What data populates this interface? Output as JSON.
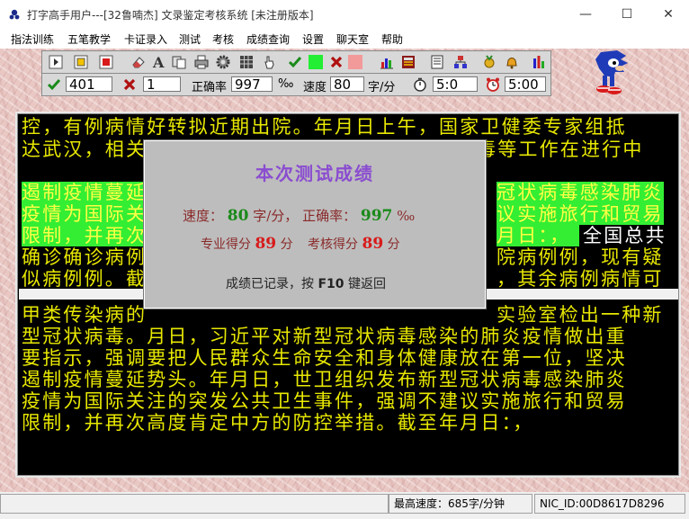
{
  "window": {
    "title": "打字高手用户---[32鲁喃杰]      文录鉴定考核系统  [未注册版本]",
    "minimize": "—",
    "maximize": "☐",
    "close": "✕"
  },
  "menu": [
    "指法训练",
    "五笔教学",
    "卡证录入",
    "测试",
    "考核",
    "成绩查询",
    "设置",
    "聊天室",
    "帮助"
  ],
  "toolbar_icons": [
    "play-icon",
    "stop-square-icon",
    "record-square-icon",
    "eraser-icon",
    "font-a-icon",
    "copy-files-icon",
    "printer-icon",
    "settings-gear-icon",
    "keyboard-grid-icon",
    "hand-pointer-icon",
    "green-check-icon",
    "green-swatch-icon",
    "red-x-icon",
    "pink-swatch-icon",
    "bar-chart-icon",
    "calculator-icon",
    "registry-icon",
    "network-icon",
    "medal-icon",
    "bell-icon",
    "equalizer-icon"
  ],
  "stats": {
    "correct_count": "401",
    "error_count": "1",
    "accuracy_label": "正确率",
    "accuracy_value": "997",
    "accuracy_unit": "‰",
    "speed_label": "速度",
    "speed_value": "80",
    "speed_unit": "字/分",
    "elapsed_time": "5:0",
    "limit_time": "5:00"
  },
  "typing": {
    "top_lines": [
      "控，有例病情好转拟近期出院。年月日上午，国家卫健委专家组抵",
      "达武汉，相关",
      "遏制疫情蔓延",
      "疫情为国际关",
      "限制，并再次",
      "确诊确诊病例",
      "似病例例。截"
    ],
    "right_fragments": [
      "毒等工作在进行中",
      "冠状病毒感染肺炎",
      "议实施旅行和贸易",
      "月日：，",
      "全国总共",
      "院病例例，现有疑",
      "，其余病例病情可"
    ],
    "bottom_lines": [
      "甲类传染病的",
      "型冠状病毒。月日，习近平对新型冠状病毒感染的肺炎疫情做出重",
      "要指示，强调要把人民群众生命安全和身体健康放在第一位，坚决",
      "遏制疫情蔓延势头。年月日，世卫组织发布新型冠状病毒感染肺炎",
      "疫情为国际关注的突发公共卫生事件，强调不建议实施旅行和贸易",
      "限制，并再次高度肯定中方的防控举措。截至年月日：，"
    ],
    "bottom_first_right": "实验室检出一种新"
  },
  "dialog": {
    "title": "本次测试成绩",
    "speed_label": "速度：",
    "speed_value": "80",
    "speed_unit": "字/分，",
    "accuracy_label": "正确率：",
    "accuracy_value": "997",
    "accuracy_unit": "‰",
    "pro_label": "专业得分",
    "pro_value": "89",
    "pro_unit": "分",
    "exam_label": "考核得分",
    "exam_value": "89",
    "exam_unit": "分",
    "footer_pre": "成绩已记录，按",
    "footer_key": "F10",
    "footer_post": "键返回"
  },
  "status": {
    "max_speed": "最高速度：685字/分钟",
    "nic_id": "NIC_ID:00D8617D8296"
  },
  "colors": {
    "text_yellow": "#e8e800",
    "highlight_green": "#33ee33",
    "dialog_title": "#8a4cd0",
    "value_green": "#1a8a1a",
    "value_red": "#d81a1a"
  }
}
